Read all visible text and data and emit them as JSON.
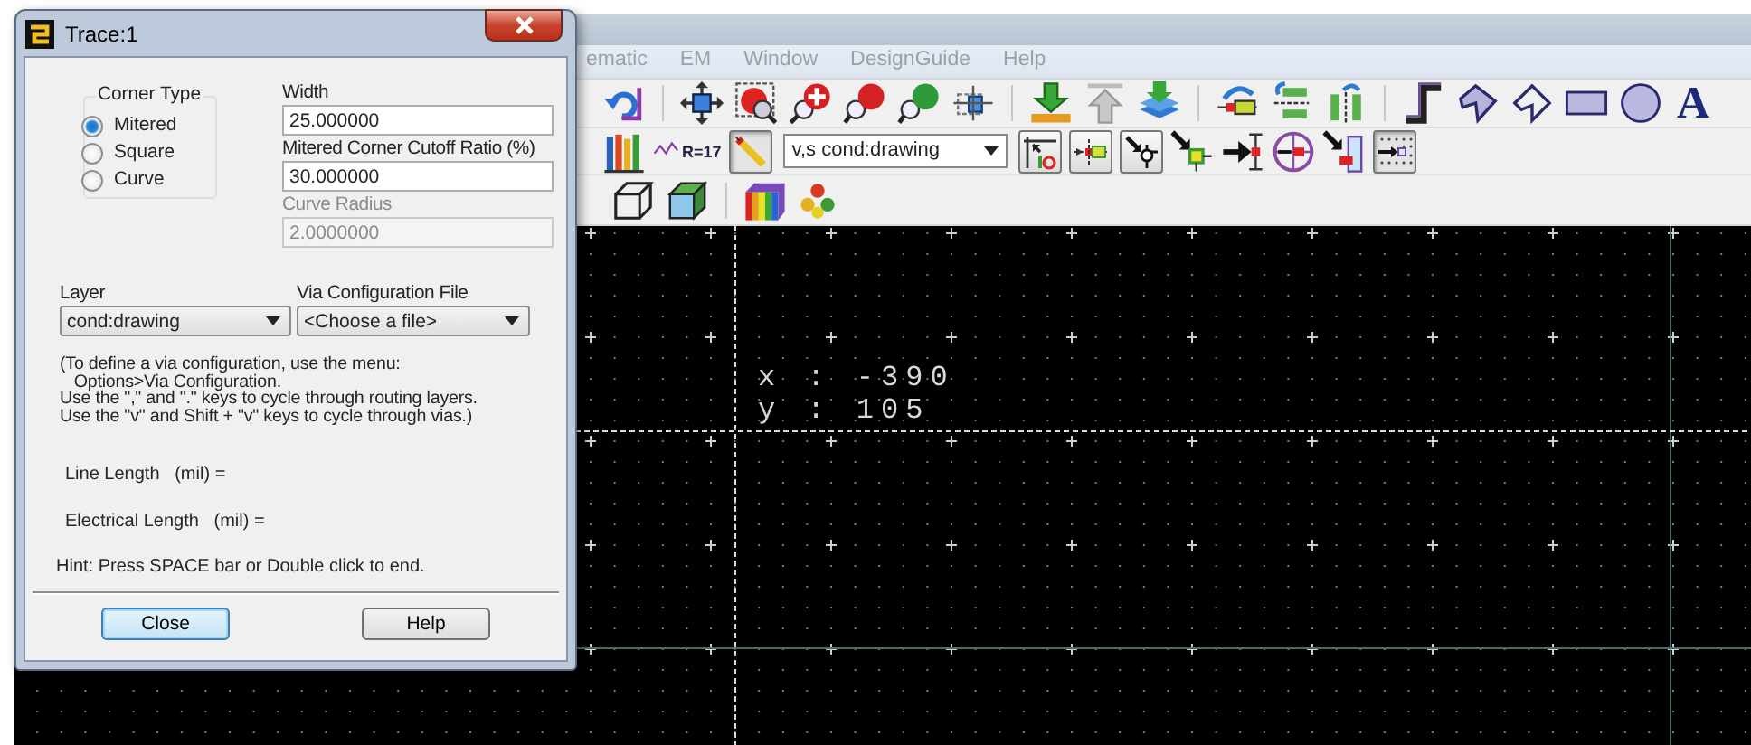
{
  "menu": [
    {
      "label": "ematic"
    },
    {
      "label": "EM"
    },
    {
      "label": "Window"
    },
    {
      "label": "DesignGuide"
    },
    {
      "label": "Help"
    }
  ],
  "toolbar_1": {
    "text_tool": "A"
  },
  "toolbar_2": {
    "resistor_caption": "R=17",
    "layer_select": "v,s cond:drawing"
  },
  "canvas": {
    "cursor_x": "x : -390",
    "cursor_y": "y : 105"
  },
  "dialog": {
    "title": "Trace:1",
    "corner_type": {
      "label": "Corner Type",
      "options": [
        {
          "label": "Mitered",
          "selected": true
        },
        {
          "label": "Square",
          "selected": false
        },
        {
          "label": "Curve",
          "selected": false
        }
      ]
    },
    "width": {
      "label": "Width",
      "value": "25.000000",
      "disabled": false
    },
    "cutoff": {
      "label": "Mitered Corner Cutoff Ratio (%)",
      "value": "30.000000",
      "disabled": false
    },
    "curve_radius": {
      "label": "Curve Radius",
      "value": "2.0000000",
      "disabled": true
    },
    "layer": {
      "label": "Layer",
      "value": "cond:drawing"
    },
    "via_file": {
      "label": "Via Configuration File",
      "value": "<Choose a file>"
    },
    "info_lines": [
      "(To define a via configuration, use the menu:",
      "   Options>Via Configuration.",
      "Use the \",\" and \".\" keys to cycle through routing layers.",
      "Use the \"v\" and Shift + \"v\" keys to cycle through vias.)"
    ],
    "line_length": "Line Length   (mil) =",
    "electrical_length": "Electrical Length   (mil) =",
    "hint": "Hint: Press SPACE bar or Double click to end.",
    "buttons": [
      {
        "label": "Close",
        "default": true
      },
      {
        "label": "Help",
        "default": false
      }
    ]
  }
}
